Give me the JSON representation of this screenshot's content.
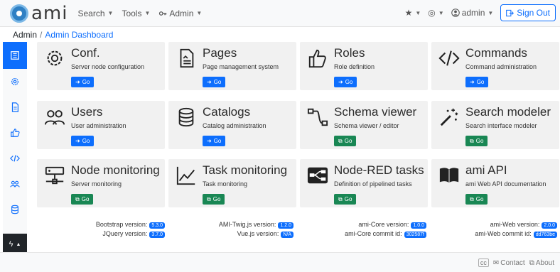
{
  "nav": {
    "logo": "ami",
    "menu": [
      {
        "label": "Search"
      },
      {
        "label": "Tools"
      },
      {
        "label": "Admin"
      }
    ],
    "right": {
      "user": "admin",
      "signout": "Sign Out"
    }
  },
  "breadcrumb": {
    "root": "Admin",
    "current": "Admin Dashboard"
  },
  "cards": [
    {
      "title": "Conf.",
      "desc": "Server node configuration",
      "go": "Go"
    },
    {
      "title": "Pages",
      "desc": "Page management system",
      "go": "Go"
    },
    {
      "title": "Roles",
      "desc": "Role definition",
      "go": "Go"
    },
    {
      "title": "Commands",
      "desc": "Command administration",
      "go": "Go"
    },
    {
      "title": "Users",
      "desc": "User administration",
      "go": "Go"
    },
    {
      "title": "Catalogs",
      "desc": "Catalog administration",
      "go": "Go"
    },
    {
      "title": "Schema viewer",
      "desc": "Schema viewer / editor",
      "go": "Go"
    },
    {
      "title": "Search modeler",
      "desc": "Search interface modeler",
      "go": "Go"
    },
    {
      "title": "Node monitoring",
      "desc": "Server monitoring",
      "go": "Go"
    },
    {
      "title": "Task monitoring",
      "desc": "Task monitoring",
      "go": "Go"
    },
    {
      "title": "Node-RED tasks",
      "desc": "Definition of pipelined tasks",
      "go": "Go"
    },
    {
      "title": "ami API",
      "desc": "ami Web API documentation",
      "go": "Go"
    }
  ],
  "versions": {
    "bootstrap_label": "Bootstrap version:",
    "bootstrap": "5.3.0",
    "jquery_label": "JQuery version:",
    "jquery": "3.7.0",
    "twig_label": "AMI-Twig.js version:",
    "twig": "1.2.0",
    "vue_label": "Vue.js version:",
    "vue": "N/A",
    "core_label": "ami-Core version:",
    "core": "1.0.0",
    "core_commit_label": "ami-Core commit id:",
    "core_commit": "302587f",
    "web_label": "ami-Web version:",
    "web": "2.0.0",
    "web_commit_label": "ami-Web commit id:",
    "web_commit": "dd763be"
  },
  "footer": {
    "contact": "Contact",
    "about": "About"
  },
  "colors": {
    "primary": "#0d6efd",
    "success": "#198754",
    "card_bg": "#f1f1f1"
  }
}
